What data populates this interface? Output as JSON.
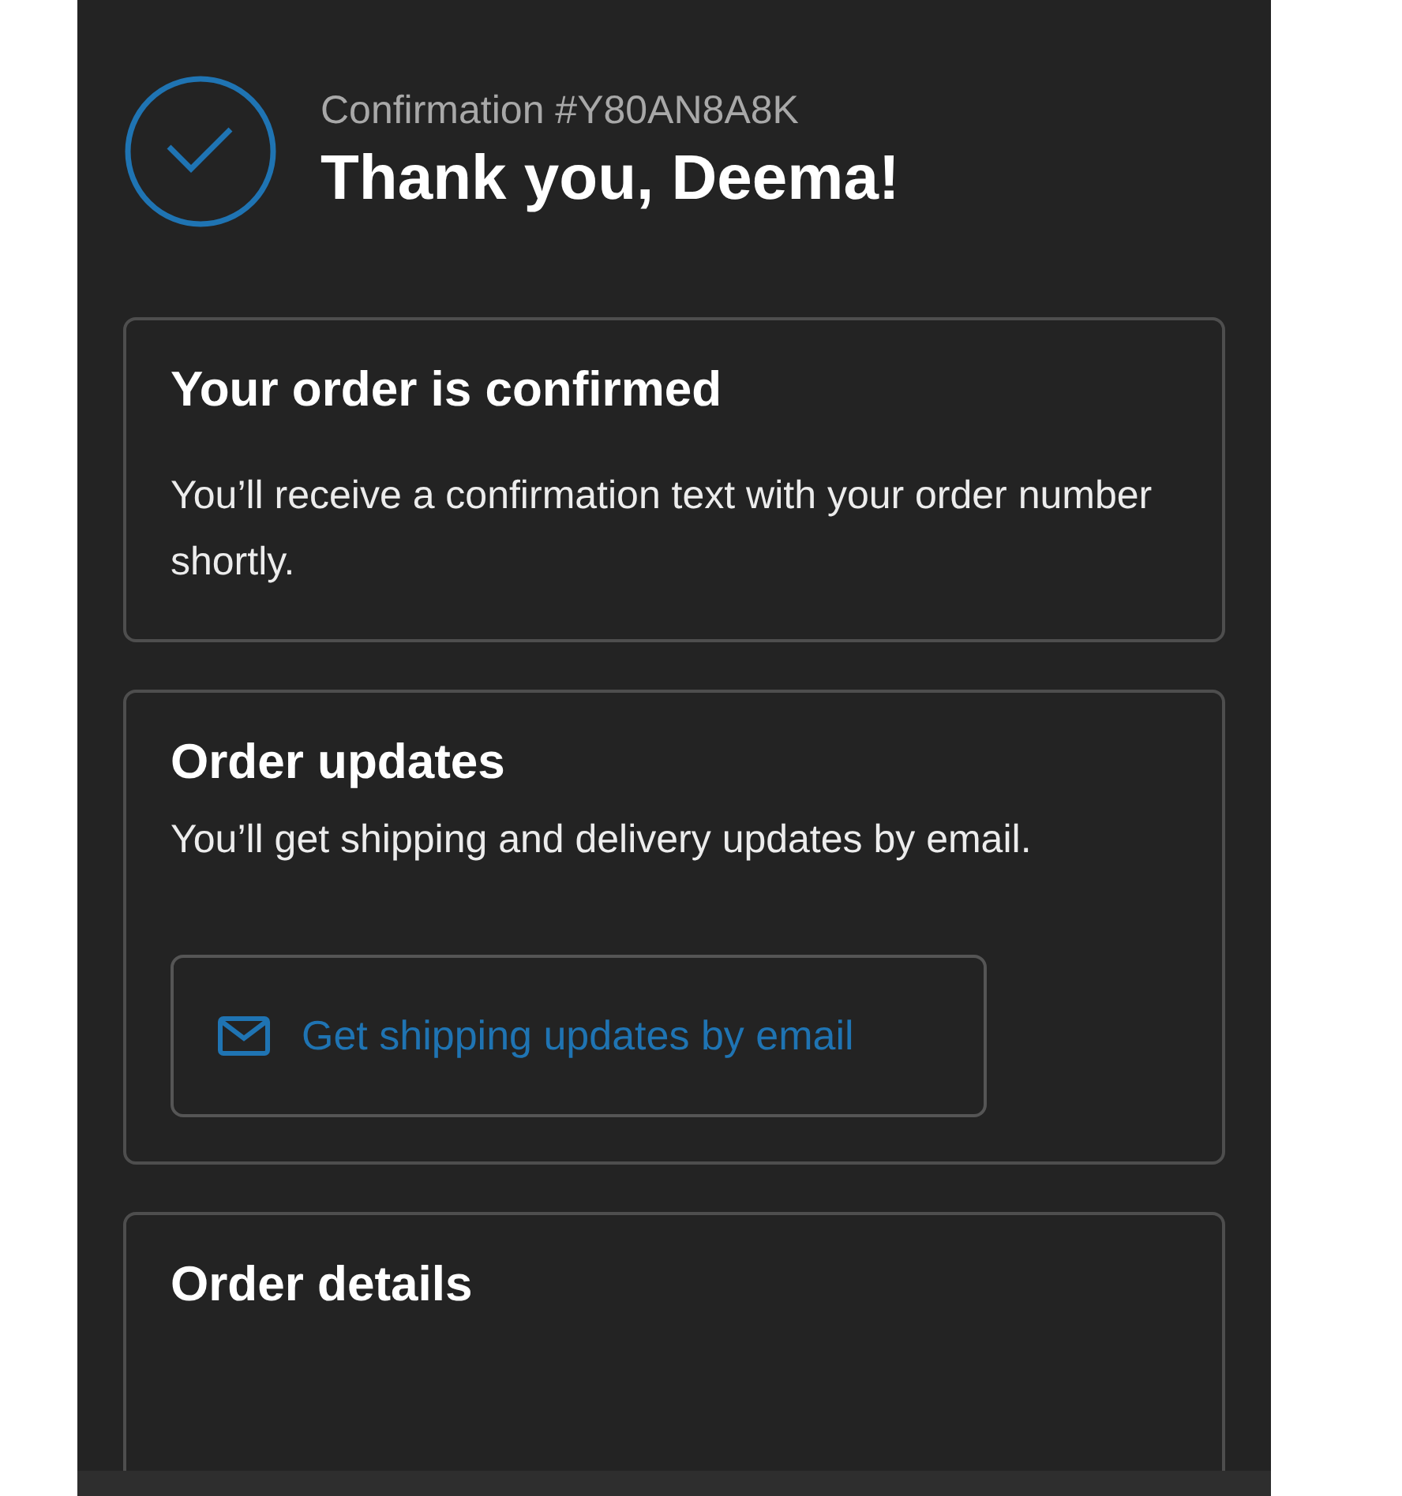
{
  "header": {
    "confirmation": "Confirmation #Y80AN8A8K",
    "title": "Thank you, Deema!"
  },
  "cards": [
    {
      "title": "Your order is confirmed",
      "body": "You’ll receive a confirmation text with your order number shortly."
    },
    {
      "title": "Order updates",
      "body": "You’ll get shipping and delivery updates by email.",
      "button": {
        "label": "Get shipping updates by email"
      }
    },
    {
      "title": "Order details"
    }
  ]
}
